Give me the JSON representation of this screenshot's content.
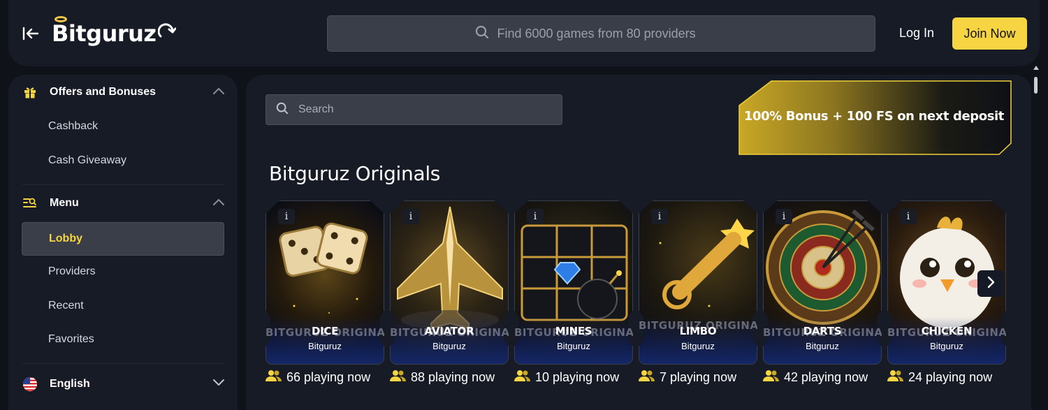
{
  "header": {
    "logo_text": "Bitguruz",
    "search_placeholder": "Find 6000 games from 80 providers",
    "login_label": "Log In",
    "join_label": "Join Now"
  },
  "sidebar": {
    "offers": {
      "label": "Offers and Bonuses",
      "items": [
        {
          "label": "Cashback"
        },
        {
          "label": "Cash Giveaway"
        }
      ]
    },
    "menu": {
      "label": "Menu",
      "items": [
        {
          "label": "Lobby",
          "active": true
        },
        {
          "label": "Providers"
        },
        {
          "label": "Recent"
        },
        {
          "label": "Favorites"
        }
      ]
    },
    "language": {
      "label": "English"
    }
  },
  "main": {
    "search_placeholder": "Search",
    "promo_text": "100% Bonus + 100 FS on next deposit",
    "section_title": "Bitguruz Originals",
    "watermark": "BITGURUZ ORIGINALS",
    "games": [
      {
        "name": "DICE",
        "provider": "Bitguruz",
        "playing": "66 playing now",
        "icon": "dice-art"
      },
      {
        "name": "AVIATOR",
        "provider": "Bitguruz",
        "playing": "88 playing now",
        "icon": "jet-art"
      },
      {
        "name": "MINES",
        "provider": "Bitguruz",
        "playing": "10 playing now",
        "icon": "mines-art"
      },
      {
        "name": "LIMBO",
        "provider": "Bitguruz",
        "playing": "7 playing now",
        "icon": "limbo-art"
      },
      {
        "name": "DARTS",
        "provider": "Bitguruz",
        "playing": "42 playing now",
        "icon": "darts-art"
      },
      {
        "name": "CHICKEN",
        "provider": "Bitguruz",
        "playing": "24 playing now",
        "icon": "chicken-art"
      }
    ]
  },
  "colors": {
    "accent": "#f7d442",
    "panel": "#171b26",
    "background": "#0f1219"
  }
}
